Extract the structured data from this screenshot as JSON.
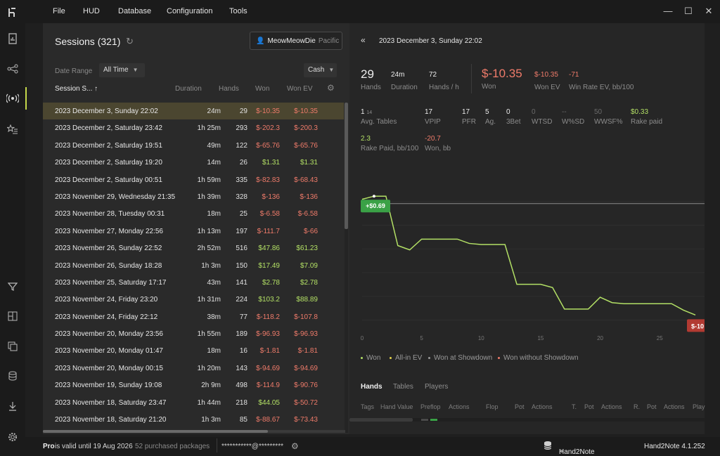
{
  "menu": [
    "File",
    "HUD",
    "Database",
    "Configuration",
    "Tools"
  ],
  "sessions": {
    "title": "Sessions (321)",
    "player_name": "MeowMeowDie",
    "player_tz": "Pacific",
    "date_range_label": "Date Range",
    "date_range_value": "All Time",
    "game_type": "Cash",
    "columns": {
      "session": "Session S...",
      "sort": "↑",
      "duration": "Duration",
      "hands": "Hands",
      "won": "Won",
      "won_ev": "Won EV"
    },
    "rows": [
      {
        "date": "2023 December 3, Sunday 22:02",
        "duration": "24m",
        "hands": "29",
        "won": "$-10.35",
        "won_ev": "$-10.35"
      },
      {
        "date": "2023 December 2, Saturday 23:42",
        "duration": "1h 25m",
        "hands": "293",
        "won": "$-202.3",
        "won_ev": "$-200.3"
      },
      {
        "date": "2023 December 2, Saturday 19:51",
        "duration": "49m",
        "hands": "122",
        "won": "$-65.76",
        "won_ev": "$-65.76"
      },
      {
        "date": "2023 December 2, Saturday 19:20",
        "duration": "14m",
        "hands": "26",
        "won": "$1.31",
        "won_ev": "$1.31"
      },
      {
        "date": "2023 December 2, Saturday 00:51",
        "duration": "1h 59m",
        "hands": "335",
        "won": "$-82.83",
        "won_ev": "$-68.43"
      },
      {
        "date": "2023 November 29, Wednesday 21:35",
        "duration": "1h 39m",
        "hands": "328",
        "won": "$-136",
        "won_ev": "$-136"
      },
      {
        "date": "2023 November 28, Tuesday 00:31",
        "duration": "18m",
        "hands": "25",
        "won": "$-6.58",
        "won_ev": "$-6.58"
      },
      {
        "date": "2023 November 27, Monday 22:56",
        "duration": "1h 13m",
        "hands": "197",
        "won": "$-111.7",
        "won_ev": "$-66"
      },
      {
        "date": "2023 November 26, Sunday 22:52",
        "duration": "2h 52m",
        "hands": "516",
        "won": "$47.86",
        "won_ev": "$61.23"
      },
      {
        "date": "2023 November 26, Sunday 18:28",
        "duration": "1h 3m",
        "hands": "150",
        "won": "$17.49",
        "won_ev": "$7.09"
      },
      {
        "date": "2023 November 25, Saturday 17:17",
        "duration": "43m",
        "hands": "141",
        "won": "$2.78",
        "won_ev": "$2.78"
      },
      {
        "date": "2023 November 24, Friday 23:20",
        "duration": "1h 31m",
        "hands": "224",
        "won": "$103.2",
        "won_ev": "$88.89"
      },
      {
        "date": "2023 November 24, Friday 22:12",
        "duration": "38m",
        "hands": "77",
        "won": "$-118.2",
        "won_ev": "$-107.8"
      },
      {
        "date": "2023 November 20, Monday 23:56",
        "duration": "1h 55m",
        "hands": "189",
        "won": "$-96.93",
        "won_ev": "$-96.93"
      },
      {
        "date": "2023 November 20, Monday 01:47",
        "duration": "18m",
        "hands": "16",
        "won": "$-1.81",
        "won_ev": "$-1.81"
      },
      {
        "date": "2023 November 20, Monday 00:15",
        "duration": "1h 20m",
        "hands": "143",
        "won": "$-94.69",
        "won_ev": "$-94.69"
      },
      {
        "date": "2023 November 19, Sunday 19:08",
        "duration": "2h 9m",
        "hands": "498",
        "won": "$-114.9",
        "won_ev": "$-90.76"
      },
      {
        "date": "2023 November 18, Saturday 23:47",
        "duration": "1h 44m",
        "hands": "218",
        "won": "$44.05",
        "won_ev": "$-50.72"
      },
      {
        "date": "2023 November 18, Saturday 21:20",
        "duration": "1h 3m",
        "hands": "85",
        "won": "$-88.67",
        "won_ev": "$-73.43"
      }
    ]
  },
  "detail": {
    "title": "2023 December 3, Sunday 22:02",
    "top_stats": [
      {
        "value": "29",
        "label": "Hands"
      },
      {
        "value": "24m",
        "label": "Duration"
      },
      {
        "value": "72",
        "label": "Hands / h"
      }
    ],
    "won": {
      "value": "$-10.35",
      "label": "Won"
    },
    "won_ev": {
      "value": "$-10.35",
      "label": "Won EV"
    },
    "winrate_ev": {
      "value": "-71",
      "label": "Win Rate EV, bb/100"
    },
    "avg_tables": {
      "value": "1",
      "sub": "14",
      "label": "Avg. Tables"
    },
    "stats_row": [
      {
        "value": "17",
        "label": "VPIP"
      },
      {
        "value": "17",
        "label": "PFR"
      },
      {
        "value": "5",
        "label": "Ag."
      },
      {
        "value": "0",
        "label": "3Bet"
      },
      {
        "value": "0",
        "label": "WTSD"
      },
      {
        "value": "--",
        "label": "W%SD"
      },
      {
        "value": "50",
        "label": "WWSF%"
      },
      {
        "value": "$0.33",
        "label": "Rake paid"
      }
    ],
    "rake_paid_bb": {
      "value": "2.3",
      "label": "Rake Paid, bb/100"
    },
    "won_bb": {
      "value": "-20.7",
      "label": "Won, bb"
    },
    "legend": [
      "Won",
      "All-in EV",
      "Won at Showdown",
      "Won without Showdown"
    ],
    "tabs": [
      "Hands",
      "Tables",
      "Players"
    ],
    "table_columns": [
      "Tags",
      "Hand Value",
      "Preflop",
      "Actions",
      "Flop",
      "Pot",
      "Actions",
      "T.",
      "Pot",
      "Actions",
      "R.",
      "Pot",
      "Actions",
      "Play"
    ]
  },
  "chart_data": {
    "type": "line",
    "series": [
      {
        "name": "Won",
        "x": [
          0,
          1,
          2,
          3,
          4,
          5,
          6,
          7,
          8,
          9,
          10,
          11,
          12,
          13,
          14,
          15,
          16,
          17,
          18,
          19,
          20,
          21,
          22,
          23,
          24,
          25,
          26,
          27,
          28
        ],
        "y": [
          0.4,
          0.69,
          0.69,
          -3.9,
          -4.3,
          -3.3,
          -3.3,
          -3.3,
          -3.3,
          -3.7,
          -3.8,
          -3.8,
          -3.8,
          -7.5,
          -7.5,
          -7.5,
          -7.8,
          -9.8,
          -9.8,
          -9.8,
          -8.7,
          -9.2,
          -9.3,
          -9.3,
          -9.3,
          -9.3,
          -9.3,
          -9.9,
          -10.35
        ]
      }
    ],
    "x_ticks": [
      "0",
      "5",
      "10",
      "15",
      "20",
      "25"
    ],
    "xlim": [
      0,
      28
    ],
    "ylim": [
      -11.7,
      2.4
    ],
    "start_label": "+$0.69",
    "end_label": "$-10",
    "colors": {
      "won": "#b3e065",
      "all_in_ev": "#e6d44a",
      "showdown": "#9a9a9a",
      "no_showdown": "#ef7b6a"
    },
    "grid": true
  },
  "status": {
    "plan": "Pro",
    "valid": " is valid until 19 Aug 2026",
    "packages": "52 purchased packages",
    "account": "***********@*********",
    "db": "Hand2Note (13)",
    "version": "Hand2Note 4.1.252"
  }
}
